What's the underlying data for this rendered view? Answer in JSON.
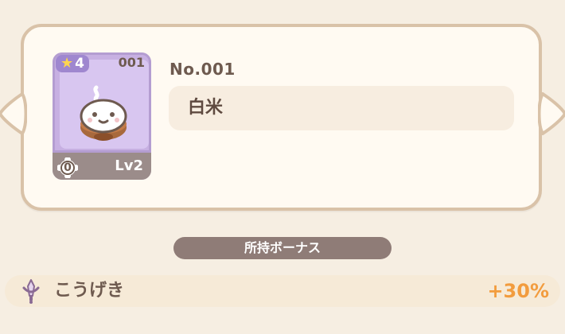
{
  "item": {
    "rarity_star_count": "4",
    "number_small": "001",
    "level_badge_number": "0",
    "level_label": "Lv2",
    "title_number": "No.001",
    "name": "白米"
  },
  "bonus": {
    "section_title": "所持ボーナス",
    "stat_label": "こうげき",
    "stat_value": "+30%"
  },
  "colors": {
    "background": "#f6eee2",
    "card_border": "#d9c2a8",
    "accent_orange": "#f29c3e",
    "purple_tile": "#c7b0e2"
  },
  "icons": {
    "left_nav": "chevron-left-icon",
    "right_nav": "chevron-right-icon",
    "rarity": "star-icon",
    "level_badge": "flower-badge-icon",
    "bonus_stat": "sword-icon"
  }
}
